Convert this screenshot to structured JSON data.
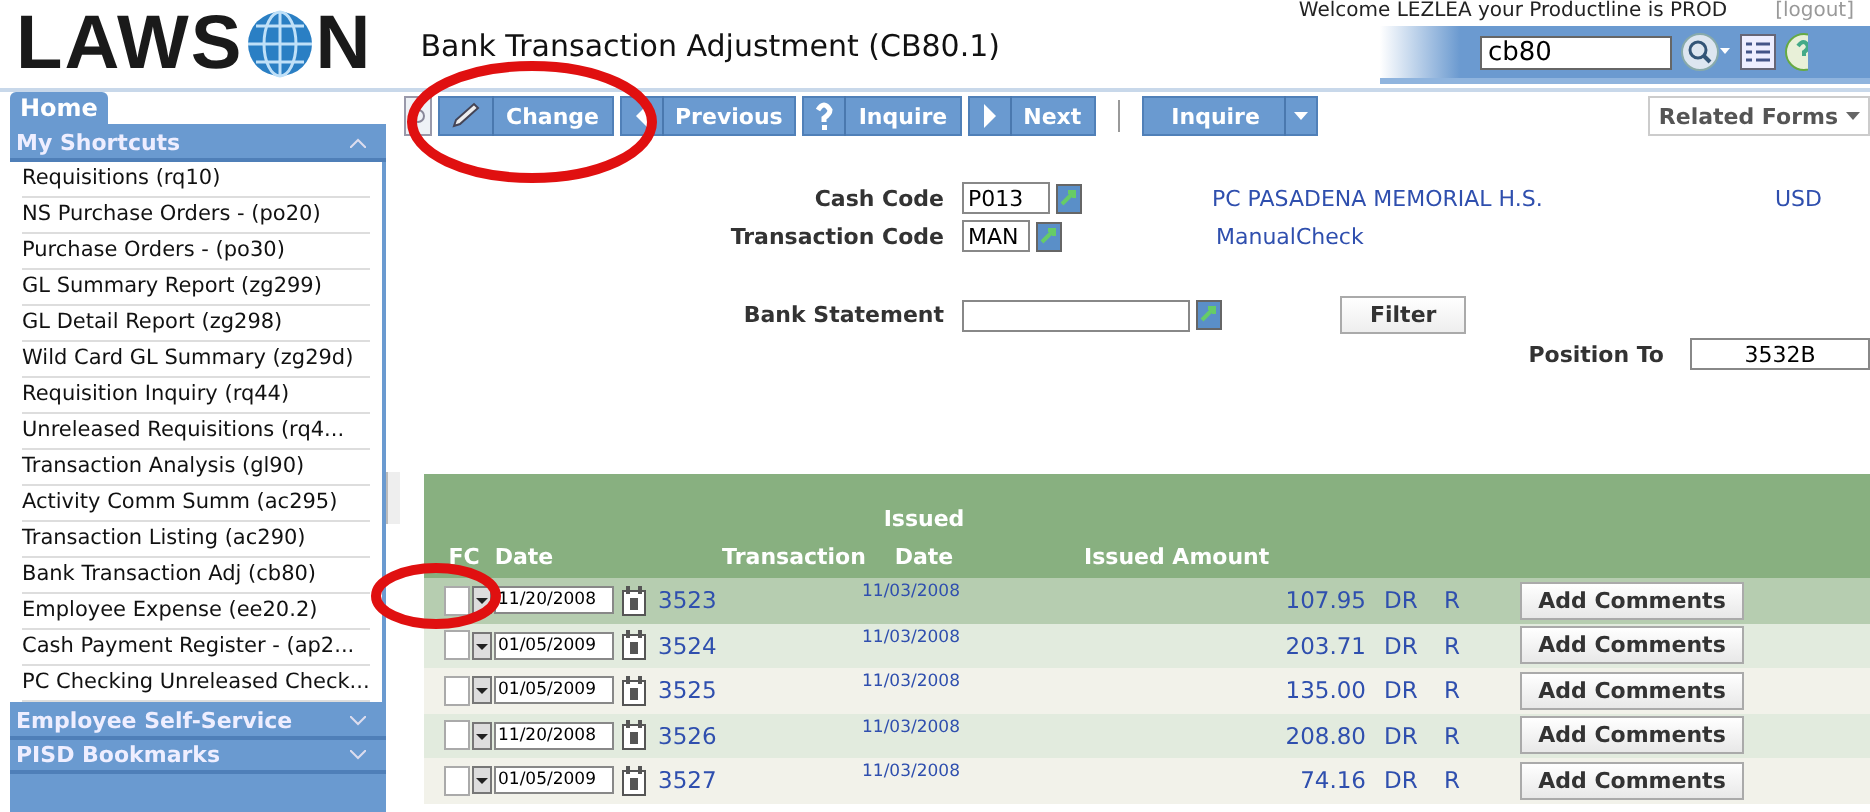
{
  "logo": {
    "before": "LAWS",
    "after": "N"
  },
  "window": {
    "title": "Bank Transaction Adjustment (CB80.1)"
  },
  "welcome": "Welcome LEZLEA your Productline is PROD",
  "logout": "[logout]",
  "search": {
    "value": "cb80"
  },
  "sidebar": {
    "tab": "Home",
    "sections": [
      {
        "title": "My Shortcuts",
        "expanded": true,
        "items": [
          "Requisitions (rq10)",
          "NS Purchase Orders - (po20)",
          "Purchase Orders - (po30)",
          "GL Summary Report (zg299)",
          "GL Detail Report (zg298)",
          "Wild Card GL Summary (zg29d)",
          "Requisition Inquiry (rq44)",
          "Unreleased Requisitions (rq4...",
          "Transaction Analysis (gl90)",
          "Activity Comm Summ (ac295)",
          "Transaction Listing (ac290)",
          "Bank Transaction Adj (cb80)",
          "Employee Expense (ee20.2)",
          "Cash Payment Register - (ap2...",
          "PC Checking Unreleased Check..."
        ]
      },
      {
        "title": "Employee Self-Service",
        "expanded": false
      },
      {
        "title": "PISD Bookmarks",
        "expanded": false
      }
    ]
  },
  "toolbar": [
    {
      "kind": "reset"
    },
    {
      "kind": "change",
      "label": "Change"
    },
    {
      "kind": "previous",
      "label": "Previous"
    },
    {
      "kind": "inquire",
      "label": "Inquire"
    },
    {
      "kind": "next",
      "label": "Next"
    },
    {
      "kind": "separator"
    },
    {
      "kind": "menu",
      "label": "Inquire"
    }
  ],
  "related_forms": "Related Forms",
  "form": {
    "cash_code": {
      "label": "Cash Code",
      "value": "P013",
      "description": "PC PASADENA MEMORIAL H.S.",
      "currency": "USD"
    },
    "transaction_code": {
      "label": "Transaction Code",
      "value": "MAN",
      "description": "ManualCheck"
    },
    "bank_statement": {
      "label": "Bank Statement"
    },
    "filter": "Filter",
    "position_to": {
      "label": "Position To",
      "value": "3532B"
    }
  },
  "table": {
    "columns": [
      {
        "bottom": "FC"
      },
      {
        "bottom": "Date"
      },
      {
        "bottom": "Transaction"
      },
      {
        "top": "Issued",
        "bottom": "Date"
      },
      {
        "bottom": "Issued Amount"
      }
    ],
    "rows": [
      {
        "selected": true,
        "fc_checked": false,
        "date": "11/20/2008",
        "transaction": "3523",
        "issued_date": "11/03/2008",
        "amount": "107.95",
        "type": "DR",
        "status": "R",
        "action": "Add Comments"
      },
      {
        "selected": false,
        "fc_checked": false,
        "date": "01/05/2009",
        "transaction": "3524",
        "issued_date": "11/03/2008",
        "amount": "203.71",
        "type": "DR",
        "status": "R",
        "action": "Add Comments"
      },
      {
        "selected": false,
        "fc_checked": false,
        "date": "01/05/2009",
        "transaction": "3525",
        "issued_date": "11/03/2008",
        "amount": "135.00",
        "type": "DR",
        "status": "R",
        "action": "Add Comments"
      },
      {
        "selected": false,
        "fc_checked": false,
        "date": "11/20/2008",
        "transaction": "3526",
        "issued_date": "11/03/2008",
        "amount": "208.80",
        "type": "DR",
        "status": "R",
        "action": "Add Comments"
      },
      {
        "selected": false,
        "fc_checked": false,
        "date": "01/05/2009",
        "transaction": "3527",
        "issued_date": "11/03/2008",
        "amount": "74.16",
        "type": "DR",
        "status": "R",
        "action": "Add Comments"
      }
    ]
  }
}
